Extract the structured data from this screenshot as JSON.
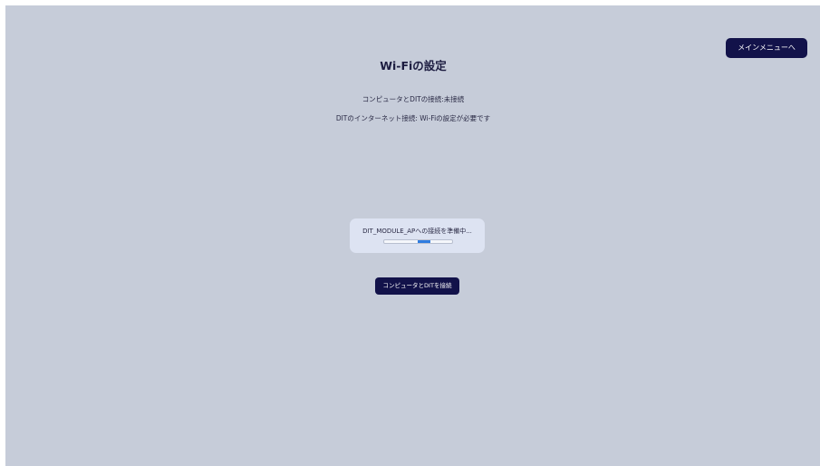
{
  "header": {
    "menu_button_label": "メインメニューへ",
    "title": "Wi-Fiの設定"
  },
  "status": {
    "pc_dit_connection": "コンピュータとDITの接続:未接続",
    "dit_internet_connection": "DITのインターネット接続: Wi-Fiの設定が必要です"
  },
  "progress": {
    "message": "DIT_MODULE_APへの接続を準備中...",
    "indeterminate": true
  },
  "actions": {
    "connect_label": "コンピュータとDITを接続"
  },
  "colors": {
    "background": "#c6ccd9",
    "button": "#12124a",
    "card": "#dde3f2",
    "progress_accent": "#2f7ce0"
  }
}
